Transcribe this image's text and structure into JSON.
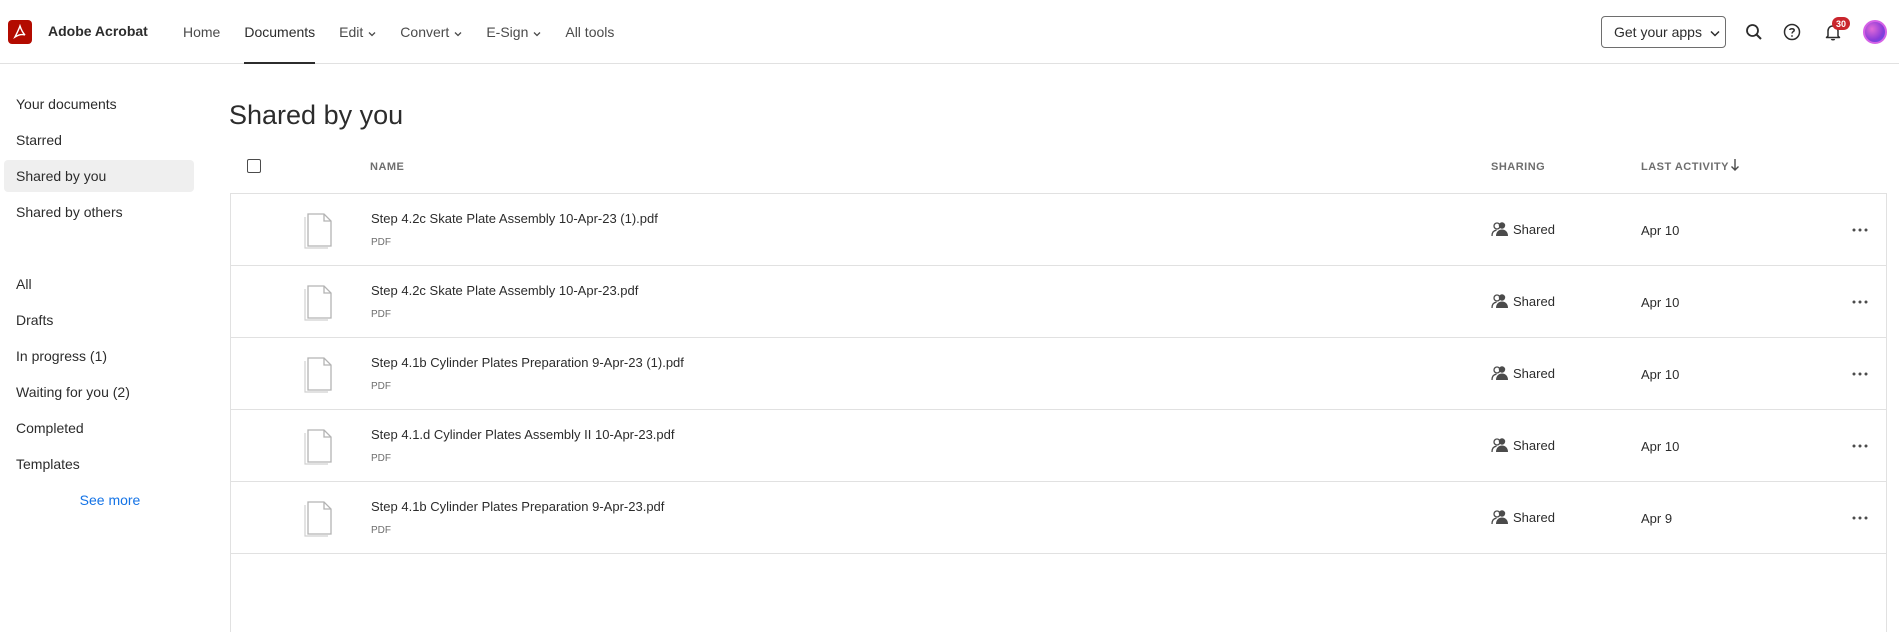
{
  "app": {
    "name": "Adobe Acrobat"
  },
  "nav": {
    "items": [
      {
        "label": "Home",
        "dropdown": false,
        "active": false
      },
      {
        "label": "Documents",
        "dropdown": false,
        "active": true
      },
      {
        "label": "Edit",
        "dropdown": true,
        "active": false
      },
      {
        "label": "Convert",
        "dropdown": true,
        "active": false
      },
      {
        "label": "E-Sign",
        "dropdown": true,
        "active": false
      },
      {
        "label": "All tools",
        "dropdown": false,
        "active": false
      }
    ]
  },
  "header": {
    "get_apps_label": "Get your apps",
    "notification_count": "30",
    "icons": [
      "search-icon",
      "help-icon",
      "bell-icon",
      "avatar"
    ]
  },
  "sidebar": {
    "primary": [
      {
        "label": "Your documents",
        "active": false
      },
      {
        "label": "Starred",
        "active": false
      },
      {
        "label": "Shared by you",
        "active": true
      },
      {
        "label": "Shared by others",
        "active": false
      }
    ],
    "secondary": [
      {
        "label": "All"
      },
      {
        "label": "Drafts"
      },
      {
        "label": "In progress (1)"
      },
      {
        "label": "Waiting for you (2)"
      },
      {
        "label": "Completed"
      },
      {
        "label": "Templates"
      }
    ],
    "see_more": "See more"
  },
  "main": {
    "title": "Shared by you",
    "columns": {
      "name": "NAME",
      "sharing": "SHARING",
      "last_activity": "LAST ACTIVITY"
    },
    "rows": [
      {
        "name": "Step 4.2c Skate Plate Assembly 10-Apr-23 (1).pdf",
        "type": "PDF",
        "sharing": "Shared",
        "date": "Apr 10"
      },
      {
        "name": "Step 4.2c Skate Plate Assembly 10-Apr-23.pdf",
        "type": "PDF",
        "sharing": "Shared",
        "date": "Apr 10"
      },
      {
        "name": "Step 4.1b Cylinder Plates Preparation 9-Apr-23 (1).pdf",
        "type": "PDF",
        "sharing": "Shared",
        "date": "Apr 10"
      },
      {
        "name": "Step 4.1.d Cylinder Plates Assembly II 10-Apr-23.pdf",
        "type": "PDF",
        "sharing": "Shared",
        "date": "Apr 10"
      },
      {
        "name": "Step 4.1b Cylinder Plates Preparation 9-Apr-23.pdf",
        "type": "PDF",
        "sharing": "Shared",
        "date": "Apr 9"
      }
    ]
  },
  "colors": {
    "brand": "#b30b00",
    "link": "#1473e6",
    "badge": "#c9252d",
    "border": "#e1e1e1"
  }
}
